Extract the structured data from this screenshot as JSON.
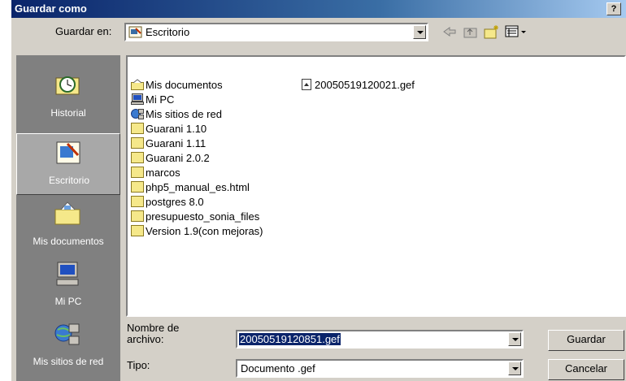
{
  "dialog": {
    "title": "Guardar como",
    "help_label": "?"
  },
  "lookin": {
    "label": "Guardar en:",
    "value": "Escritorio"
  },
  "toolbar": {
    "icons": [
      "back-arrow-icon",
      "up-folder-icon",
      "new-folder-icon",
      "view-menu-icon"
    ]
  },
  "places": [
    {
      "label": "Historial",
      "icon": "history-icon"
    },
    {
      "label": "Escritorio",
      "icon": "desktop-icon",
      "active": true
    },
    {
      "label": "Mis documentos",
      "icon": "my-documents-icon"
    },
    {
      "label": "Mi PC",
      "icon": "my-computer-icon"
    },
    {
      "label": "Mis sitios de red",
      "icon": "network-places-icon"
    }
  ],
  "files": [
    {
      "name": "Mis documentos",
      "type": "special-docs"
    },
    {
      "name": "Mi PC",
      "type": "computer"
    },
    {
      "name": "Mis sitios de red",
      "type": "network"
    },
    {
      "name": "Guarani 1.10",
      "type": "folder"
    },
    {
      "name": "Guarani 1.11",
      "type": "folder"
    },
    {
      "name": "Guarani 2.0.2",
      "type": "folder"
    },
    {
      "name": "marcos",
      "type": "folder"
    },
    {
      "name": "php5_manual_es.html",
      "type": "folder"
    },
    {
      "name": "postgres 8.0",
      "type": "folder"
    },
    {
      "name": "presupuesto_sonia_files",
      "type": "folder"
    },
    {
      "name": "Version 1.9(con mejoras)",
      "type": "folder"
    },
    {
      "name": "20050519120021.gef",
      "type": "file"
    }
  ],
  "filename": {
    "label": "Nombre de\narchivo:",
    "value": "20050519120851.gef"
  },
  "filetype": {
    "label": "Tipo:",
    "value": "Documento .gef"
  },
  "buttons": {
    "save": "Guardar",
    "cancel": "Cancelar"
  }
}
